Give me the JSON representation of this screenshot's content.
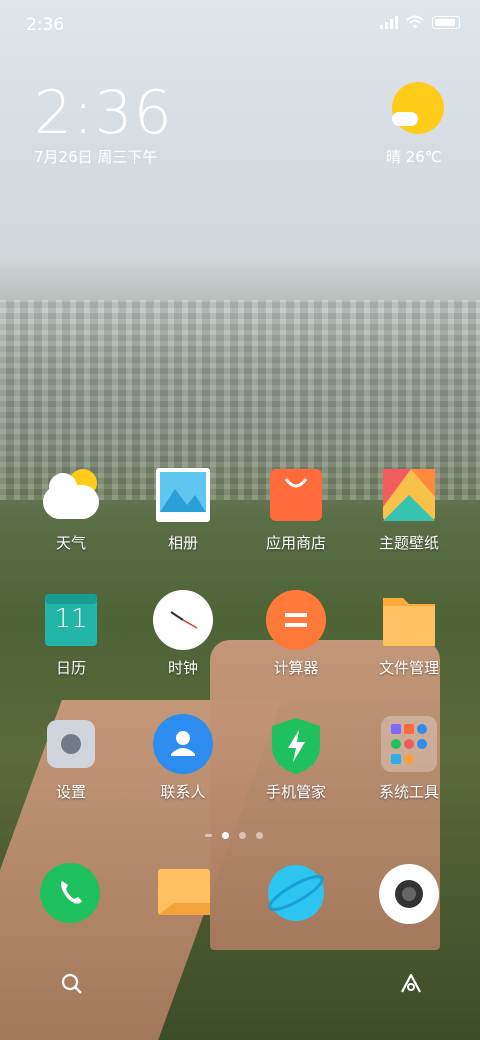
{
  "status_bar": {
    "time": "2:36"
  },
  "lock_clock": {
    "time": "2:36",
    "date": "7月26日 周三下午"
  },
  "weather_widget": {
    "text": "晴 26℃",
    "icon": "sunny-cloud-icon"
  },
  "apps": [
    {
      "label": "天气",
      "icon": "weather-icon"
    },
    {
      "label": "相册",
      "icon": "gallery-icon"
    },
    {
      "label": "应用商店",
      "icon": "app-store-icon"
    },
    {
      "label": "主题壁纸",
      "icon": "themes-icon"
    },
    {
      "label": "日历",
      "icon": "calendar-icon",
      "badge": "11"
    },
    {
      "label": "时钟",
      "icon": "clock-icon"
    },
    {
      "label": "计算器",
      "icon": "calculator-icon"
    },
    {
      "label": "文件管理",
      "icon": "file-manager-icon"
    },
    {
      "label": "设置",
      "icon": "settings-icon"
    },
    {
      "label": "联系人",
      "icon": "contacts-icon"
    },
    {
      "label": "手机管家",
      "icon": "security-icon"
    },
    {
      "label": "系统工具",
      "icon": "tools-folder-icon"
    }
  ],
  "page_indicator": {
    "pages": 3,
    "current": 1
  },
  "dock": [
    {
      "icon": "phone-icon"
    },
    {
      "icon": "notes-icon"
    },
    {
      "icon": "browser-icon"
    },
    {
      "icon": "camera-icon"
    }
  ],
  "bottom_bar": [
    {
      "icon": "search-icon"
    },
    {
      "icon": "assistant-icon"
    }
  ],
  "colors": {
    "accent_green": "#1fc060",
    "accent_orange": "#ff6a3c",
    "accent_blue": "#2d8cf0"
  }
}
